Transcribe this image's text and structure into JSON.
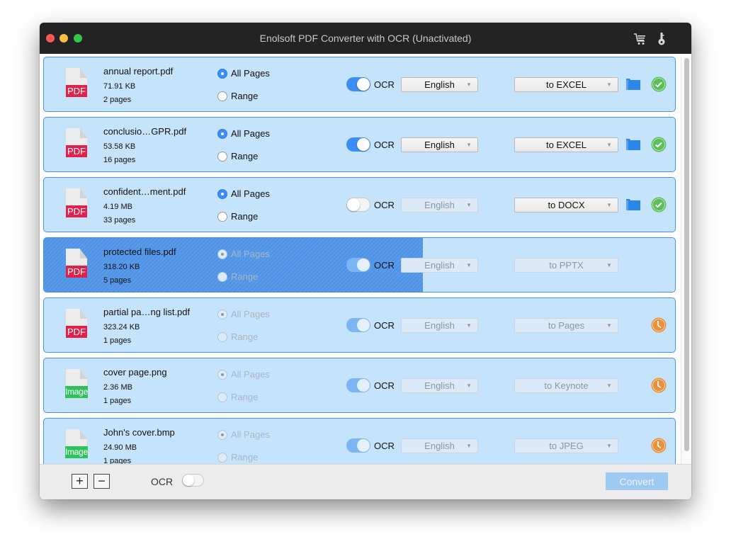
{
  "window": {
    "title": "Enolsoft PDF Converter with OCR (Unactivated)",
    "toolbar_icons": [
      "cart-icon",
      "key-icon"
    ]
  },
  "labels": {
    "all_pages": "All Pages",
    "range": "Range",
    "ocr": "OCR"
  },
  "files": [
    {
      "name": "annual report.pdf",
      "size": "71.91 KB",
      "pages": "2 pages",
      "type_badge": "PDF",
      "page_mode": "all",
      "enabled": true,
      "ocr_on": true,
      "language": "English",
      "format": "to EXCEL",
      "status": "done"
    },
    {
      "name": "conclusio…GPR.pdf",
      "size": "53.58 KB",
      "pages": "16 pages",
      "type_badge": "PDF",
      "page_mode": "all",
      "enabled": true,
      "ocr_on": true,
      "language": "English",
      "format": "to EXCEL",
      "status": "done"
    },
    {
      "name": "confident…ment.pdf",
      "size": "4.19 MB",
      "pages": "33 pages",
      "type_badge": "PDF",
      "page_mode": "all",
      "enabled": true,
      "ocr_on": false,
      "language": "English",
      "format": "to DOCX",
      "status": "done"
    },
    {
      "name": "protected files.pdf",
      "size": "318.20 KB",
      "pages": "5 pages",
      "type_badge": "PDF",
      "page_mode": "all",
      "enabled": false,
      "ocr_on": true,
      "language": "English",
      "format": "to PPTX",
      "status": "converting",
      "progress": 0.6
    },
    {
      "name": "partial pa…ng list.pdf",
      "size": "323.24 KB",
      "pages": "1 pages",
      "type_badge": "PDF",
      "page_mode": "all",
      "enabled": false,
      "ocr_on": true,
      "language": "English",
      "format": "to Pages",
      "status": "waiting"
    },
    {
      "name": "cover page.png",
      "size": "2.36 MB",
      "pages": "1 pages",
      "type_badge": "Image",
      "page_mode": "all",
      "enabled": false,
      "ocr_on": true,
      "language": "English",
      "format": "to Keynote",
      "status": "waiting"
    },
    {
      "name": "John's cover.bmp",
      "size": "24.90 MB",
      "pages": "1 pages",
      "type_badge": "Image",
      "page_mode": "all",
      "enabled": false,
      "ocr_on": true,
      "language": "English",
      "format": "to JPEG",
      "status": "waiting"
    }
  ],
  "footer": {
    "add_label": "+",
    "remove_label": "−",
    "ocr_label": "OCR",
    "ocr_on": false,
    "convert_label": "Convert"
  },
  "colors": {
    "row_bg": "#c6e3fc",
    "accent": "#3d8ef4",
    "pdf_badge": "#e3204a",
    "image_badge": "#2fc15b",
    "done": "#5cbf5a",
    "waiting": "#e8913c"
  }
}
